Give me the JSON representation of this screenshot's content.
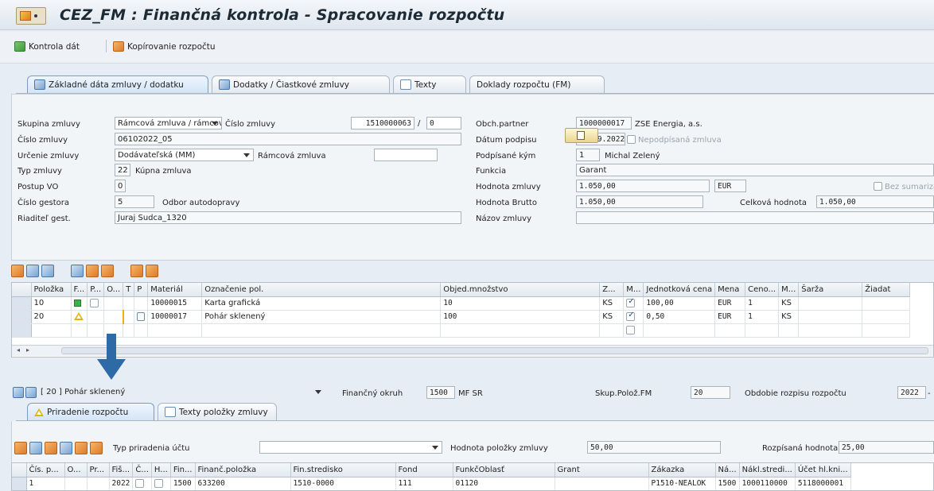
{
  "window": {
    "title": "CEZ_FM : Finančná kontrola - Spracovanie rozpočtu"
  },
  "toolbar": {
    "check_label": "Kontrola dát",
    "copy_label": "Kopírovanie rozpočtu"
  },
  "tabs": [
    {
      "label": "Základné dáta zmluvy / dodatku",
      "active": true
    },
    {
      "label": "Dodatky / Čiastkové zmluvy"
    },
    {
      "label": "Texty"
    },
    {
      "label": "Doklady rozpočtu (FM)"
    }
  ],
  "form": {
    "skupina_label": "Skupina zmluvy",
    "skupina_value": "Rámcová zmluva / rámcová ...",
    "cislo_zmluvy_top_label": "Číslo zmluvy",
    "cislo_zmluvy_top_value": "1510000063",
    "slash": "/",
    "cislo_suffix": "0",
    "cislo_label": "Číslo zmluvy",
    "cislo_value": "06102022_05",
    "urcenie_label": "Určenie zmluvy",
    "urcenie_value": "Dodávateľská (MM)",
    "ramcova_label": "Rámcová zmluva",
    "ramcova_value": "",
    "typ_label": "Typ zmluvy",
    "typ_code": "22",
    "typ_text": "Kúpna zmluva",
    "postup_label": "Postup VO",
    "postup_value": "0",
    "gestor_label": "Číslo gestora",
    "gestor_code": "5",
    "gestor_text": "Odbor autodopravy",
    "riaditel_label": "Riaditeľ gest.",
    "riaditel_value": "Juraj Sudca_1320",
    "partner_label": "Obch.partner",
    "partner_code": "1000000017",
    "partner_name": "ZSE Energia, a.s.",
    "datum_label": "Dátum podpisu",
    "datum_value": "21.09.2022",
    "nepodpisana_label": "Nepodpísaná zmluva",
    "podpisane_label": "Podpísané kým",
    "podpisane_code": "1",
    "podpisane_name": "Michal Zelený",
    "funkcia_label": "Funkcia",
    "funkcia_value": "Garant",
    "hodnota_label": "Hodnota zmluvy",
    "hodnota_value": "1.050,00",
    "mena_value": "EUR",
    "bez_sum_label": "Bez sumarizácie",
    "brutto_label": "Hodnota Brutto",
    "brutto_value": "1.050,00",
    "celkova_label": "Celková hodnota",
    "celkova_value": "1.050,00",
    "nazov_label": "Názov zmluvy",
    "nazov_value": ""
  },
  "grid": {
    "headers": [
      "Položka",
      "F...",
      "P...",
      "O...",
      "T",
      "P",
      "Materiál",
      "Označenie pol.",
      "Objed.množstvo",
      "Z...",
      "M...",
      "Jednotková cena",
      "Mena",
      "Ceno...",
      "M...",
      "Šarža",
      "Žiadat"
    ],
    "rows": [
      {
        "polozka": "10",
        "status": "green",
        "material": "10000015",
        "oznacenie": "Karta grafická",
        "mnozstvo": "10",
        "jednotka": "KS",
        "checked": true,
        "cena": "100,00",
        "mena": "EUR",
        "ceno": "1",
        "m": "KS"
      },
      {
        "polozka": "20",
        "status": "yellow",
        "material": "10000017",
        "oznacenie": "Pohár sklenený",
        "mnozstvo": "100",
        "jednotka": "KS",
        "checked": true,
        "cena": "0,50",
        "mena": "EUR",
        "ceno": "1",
        "m": "KS"
      }
    ]
  },
  "item_select": {
    "value": "[ 20 ] Pohár sklenený",
    "fin_okruh_label": "Finančný okruh",
    "fin_okruh_code": "1500",
    "fin_okruh_text": "MF SR",
    "skup_label": "Skup.Polož.FM",
    "skup_value": "20",
    "obdobie_label": "Obdobie rozpisu rozpočtu",
    "obdobie_value": "2022",
    "obdobie_suffix": "-"
  },
  "tabs2": [
    {
      "label": "Priradenie rozpočtu",
      "active": true
    },
    {
      "label": "Texty položky zmluvy"
    }
  ],
  "assign": {
    "typ_label": "Typ priradenia účtu",
    "typ_value": "",
    "hodnota_label": "Hodnota položky zmluvy",
    "hodnota_value": "50,00",
    "rozpisana_label": "Rozpísaná hodnota",
    "rozpisana_value": "25,00"
  },
  "grid2": {
    "headers": [
      "Čís. p...",
      "O...",
      "Pr...",
      "Fiš...",
      "Č...",
      "H...",
      "Fin...",
      "Finanč.položka",
      "Fin.stredisko",
      "Fond",
      "FunkčOblasť",
      "Grant",
      "Zákazka",
      "Ná...",
      "Nákl.stredi...",
      "Účet hl.kni..."
    ],
    "row": [
      "1",
      "",
      "",
      "2022",
      "",
      "",
      "1500",
      "633200",
      "1510-0000",
      "111",
      "01120",
      "",
      "P1510-NEALOK",
      "1500",
      "1000110000",
      "5118000001"
    ]
  }
}
